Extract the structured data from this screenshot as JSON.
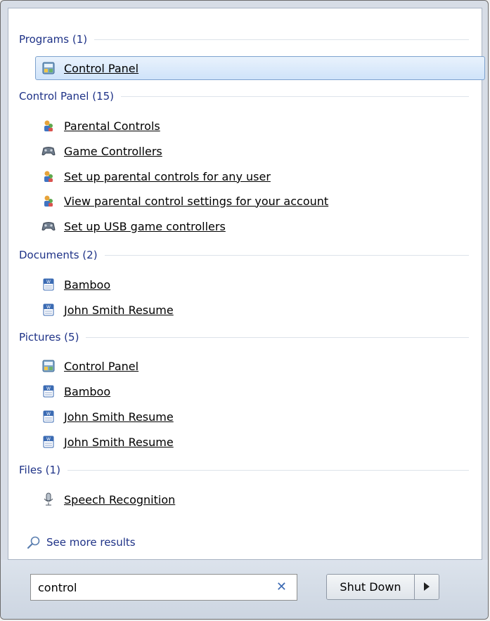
{
  "groups": [
    {
      "label": "Programs (1)"
    },
    {
      "label": "Control Panel (15)"
    },
    {
      "label": "Documents (2)"
    },
    {
      "label": "Pictures (5)"
    },
    {
      "label": "Files (1)"
    }
  ],
  "items": {
    "programs": [
      {
        "label": "Control Panel",
        "icon": "control-panel-icon",
        "selected": true
      }
    ],
    "control_panel": [
      {
        "label": "Parental Controls",
        "icon": "parental-controls-icon"
      },
      {
        "label": "Game Controllers",
        "icon": "gamepad-icon"
      },
      {
        "label": "Set up parental controls for any user",
        "icon": "parental-controls-icon"
      },
      {
        "label": "View parental control settings for your account",
        "icon": "parental-controls-icon"
      },
      {
        "label": "Set up USB game controllers",
        "icon": "gamepad-icon"
      }
    ],
    "documents": [
      {
        "label": "Bamboo",
        "icon": "word-document-icon"
      },
      {
        "label": "John Smith Resume",
        "icon": "word-document-icon"
      }
    ],
    "pictures": [
      {
        "label": "Control Panel",
        "icon": "control-panel-icon"
      },
      {
        "label": "Bamboo",
        "icon": "word-document-icon"
      },
      {
        "label": "John Smith Resume",
        "icon": "word-document-icon"
      },
      {
        "label": "John Smith Resume",
        "icon": "word-document-icon"
      }
    ],
    "files": [
      {
        "label": "Speech Recognition",
        "icon": "microphone-icon"
      }
    ]
  },
  "see_more": {
    "label": "See more results",
    "icon": "search-icon"
  },
  "search": {
    "value": "control",
    "clear_icon": "clear-icon"
  },
  "shutdown": {
    "label": "Shut Down",
    "arrow_icon": "arrow-right-icon"
  },
  "colors": {
    "group_header": "#1e3287",
    "selection_border": "#7da2ce",
    "selection_fill": "#cfe3fa",
    "footer": "#ccd5e1"
  }
}
